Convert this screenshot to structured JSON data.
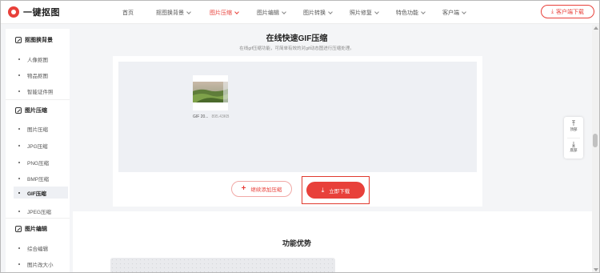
{
  "header": {
    "logo_text": "一键抠图",
    "nav": [
      {
        "label": "首页"
      },
      {
        "label": "抠图换背景"
      },
      {
        "label": "图片压缩"
      },
      {
        "label": "图片编辑"
      },
      {
        "label": "图片转换"
      },
      {
        "label": "照片修复"
      },
      {
        "label": "特色功能"
      },
      {
        "label": "客户端"
      }
    ],
    "active_nav": "图片压缩",
    "download_button": "客户端下载"
  },
  "sidebar": {
    "sections": [
      {
        "title": "抠图换背景",
        "items": [
          "人像抠图",
          "物品抠图",
          "智能证件照"
        ]
      },
      {
        "title": "图片压缩",
        "items": [
          "图片压缩",
          "JPG压缩",
          "PNG压缩",
          "BMP压缩",
          "GIF压缩",
          "JPEG压缩"
        ]
      },
      {
        "title": "图片编辑",
        "items": [
          "综合编辑",
          "图片改大小"
        ]
      }
    ],
    "active_item": "GIF压缩"
  },
  "main": {
    "title": "在线快速GIF压缩",
    "subtitle": "在线gif压缩功能，可简单有效的对gif动态图进行压缩处理。",
    "file": {
      "name": "GIF 20...",
      "size": "895.43KB"
    },
    "add_button": "继续添加压缩",
    "download_button": "立即下载",
    "feature_title": "功能优势"
  },
  "float_tools": {
    "top": "顶部",
    "bottom": "底部"
  },
  "colors": {
    "accent": "#e8403a",
    "highlight_box": "#e03a2f",
    "drop_area": "#eef0f4"
  }
}
